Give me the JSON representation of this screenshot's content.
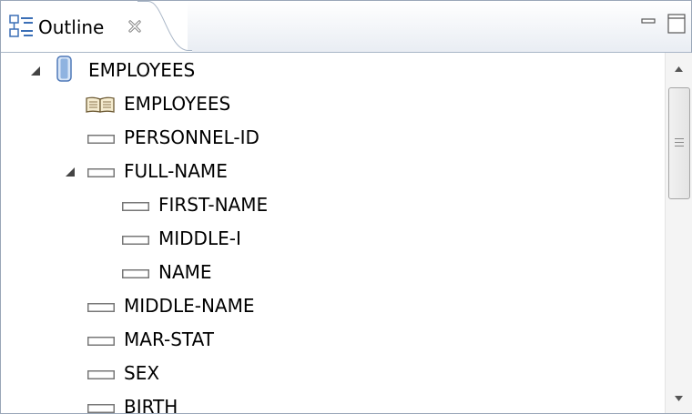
{
  "view": {
    "tab_title": "Outline",
    "tab_icon": "outline-icon",
    "close_icon": "close-icon",
    "minimize_icon": "minimize-icon",
    "maximize_icon": "maximize-icon"
  },
  "tree": {
    "root": {
      "label": "EMPLOYEES",
      "icon": "database-icon",
      "expanded": true
    },
    "items": [
      {
        "label": "EMPLOYEES",
        "icon": "book-icon"
      },
      {
        "label": "PERSONNEL-ID",
        "icon": "field-icon"
      },
      {
        "label": "FULL-NAME",
        "icon": "field-icon",
        "expanded": true
      },
      {
        "label": "FIRST-NAME",
        "icon": "field-icon"
      },
      {
        "label": "MIDDLE-I",
        "icon": "field-icon"
      },
      {
        "label": "NAME",
        "icon": "field-icon"
      },
      {
        "label": "MIDDLE-NAME",
        "icon": "field-icon"
      },
      {
        "label": "MAR-STAT",
        "icon": "field-icon"
      },
      {
        "label": "SEX",
        "icon": "field-icon"
      },
      {
        "label": "BIRTH",
        "icon": "field-icon"
      }
    ]
  },
  "colors": {
    "border": "#9aa7b8",
    "database_icon": "#6f95c9",
    "book_icon": "#b7a06a"
  }
}
